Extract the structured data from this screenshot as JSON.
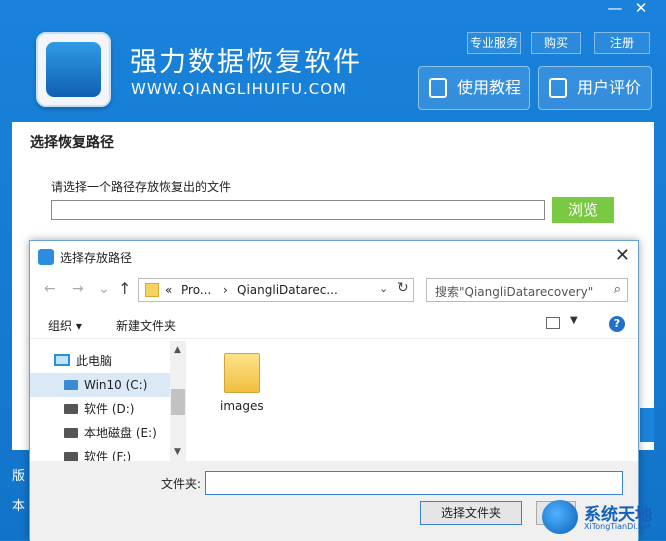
{
  "app": {
    "title": "强力数据恢复软件",
    "url": "WWW.QIANGLIHUIFU.COM",
    "links": [
      "专业服务",
      "购买",
      "注册"
    ],
    "buttons": [
      "使用教程",
      "用户评价"
    ],
    "window_controls": [
      "—",
      "✕"
    ]
  },
  "panel": {
    "title": "选择恢复路径",
    "prompt": "请选择一个路径存放恢复出的文件",
    "path_value": "",
    "browse_label": "浏览"
  },
  "bottom_strip": "版本",
  "dialog": {
    "title": "选择存放路径",
    "close": "✕",
    "nav": {
      "back": "←",
      "forward": "→",
      "recent": "⌄",
      "up": "↑"
    },
    "address": {
      "sep1": "«",
      "crumb1": "Pro...",
      "sep2": "›",
      "crumb2": "QiangliDatarec...",
      "refresh": "↻"
    },
    "search_placeholder": "搜索\"QiangliDatarecovery\"",
    "toolbar": {
      "organize": "组织 ▾",
      "new_folder": "新建文件夹",
      "help": "?"
    },
    "sidebar": {
      "items": [
        {
          "label": "此电脑"
        },
        {
          "label": "Win10 (C:)"
        },
        {
          "label": "软件 (D:)"
        },
        {
          "label": "本地磁盘 (E:)"
        },
        {
          "label": "软件 (F:)"
        }
      ]
    },
    "files": [
      {
        "name": "images"
      }
    ],
    "footer": {
      "folder_label": "文件夹:",
      "folder_value": "",
      "select_button": "选择文件夹"
    }
  },
  "watermark": {
    "text": "系统天地",
    "sub": "XiTongTianDi.net"
  }
}
